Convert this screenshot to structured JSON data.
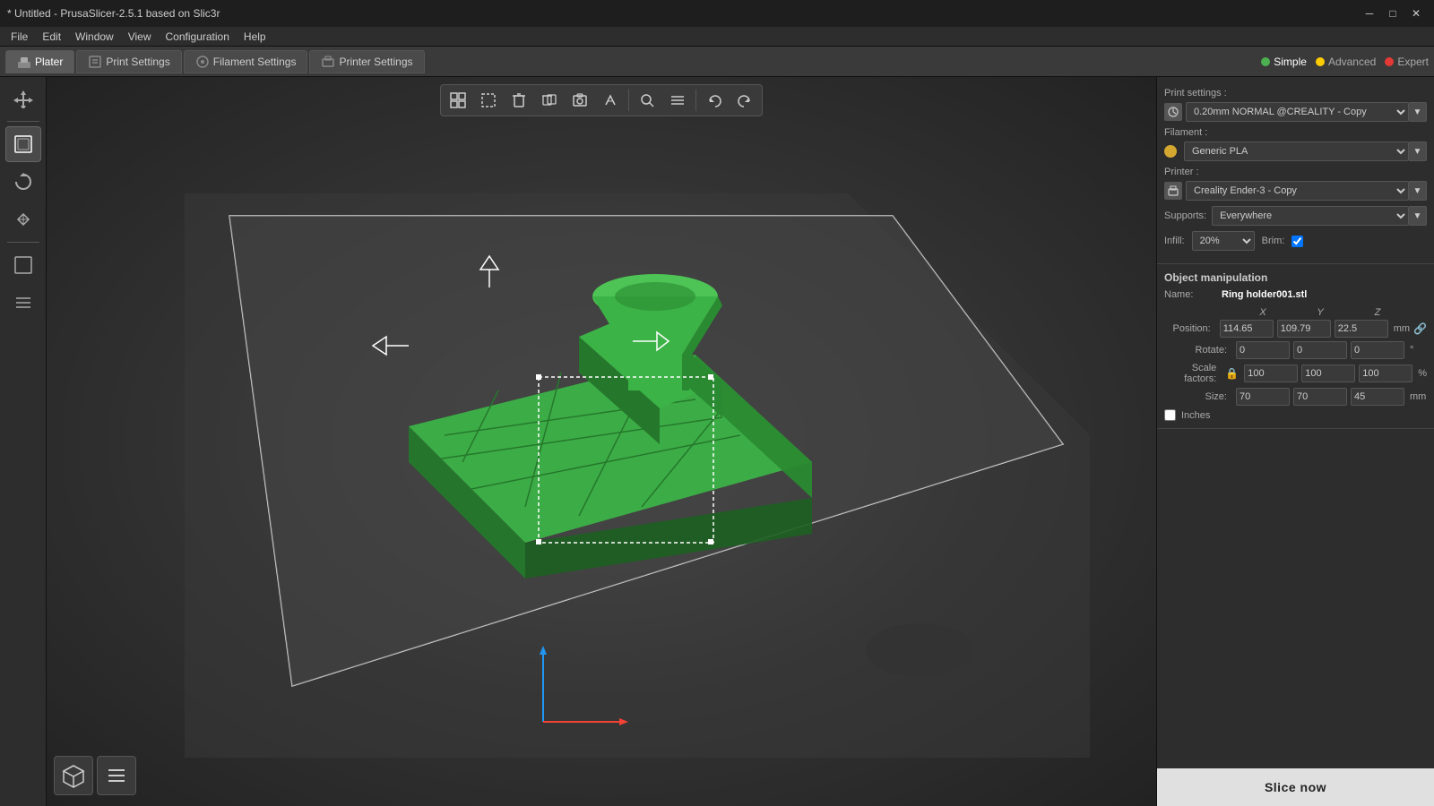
{
  "titlebar": {
    "title": "* Untitled - PrusaSlicer-2.5.1 based on Slic3r",
    "minimize": "─",
    "maximize": "□",
    "close": "✕"
  },
  "menubar": {
    "items": [
      "File",
      "Edit",
      "Window",
      "View",
      "Configuration",
      "Help"
    ]
  },
  "tabs": [
    {
      "id": "plater",
      "label": "Plater",
      "active": true
    },
    {
      "id": "print-settings",
      "label": "Print Settings",
      "active": false
    },
    {
      "id": "filament-settings",
      "label": "Filament Settings",
      "active": false
    },
    {
      "id": "printer-settings",
      "label": "Printer Settings",
      "active": false
    }
  ],
  "modes": [
    {
      "id": "simple",
      "label": "Simple",
      "dot": "green",
      "active": true
    },
    {
      "id": "advanced",
      "label": "Advanced",
      "dot": "yellow",
      "active": false
    },
    {
      "id": "expert",
      "label": "Expert",
      "dot": "red",
      "active": false
    }
  ],
  "viewport_tools": [
    {
      "id": "arrange",
      "icon": "⊞"
    },
    {
      "id": "select",
      "icon": "✦"
    },
    {
      "id": "cut",
      "icon": "⬡"
    },
    {
      "id": "layer",
      "icon": "⧠"
    },
    {
      "id": "support-paint",
      "icon": "◉"
    },
    {
      "id": "seam-paint",
      "icon": "⊙"
    },
    {
      "id": "search",
      "icon": "🔍"
    },
    {
      "id": "menu",
      "icon": "≡"
    },
    {
      "id": "undo",
      "icon": "↶"
    },
    {
      "id": "redo",
      "icon": "↷"
    }
  ],
  "left_tools": [
    {
      "id": "move",
      "icon": "✛",
      "active": false
    },
    {
      "id": "select-box",
      "icon": "⬚",
      "active": true
    },
    {
      "id": "rotate",
      "icon": "↻",
      "active": false
    },
    {
      "id": "scale",
      "icon": "⤡",
      "active": false
    },
    {
      "id": "cut-tool",
      "icon": "⬜",
      "active": false
    },
    {
      "id": "layers",
      "icon": "≡",
      "active": false
    }
  ],
  "right_panel": {
    "print_settings_label": "Print settings :",
    "print_settings_value": "0.20mm NORMAL @CREALITY - Copy",
    "filament_label": "Filament :",
    "filament_value": "Generic PLA",
    "printer_label": "Printer :",
    "printer_value": "Creality Ender-3 - Copy",
    "supports_label": "Supports:",
    "supports_value": "Everywhere",
    "infill_label": "Infill:",
    "infill_value": "20%",
    "brim_label": "Brim:",
    "brim_checked": true,
    "object_manipulation": {
      "title": "Object manipulation",
      "name_label": "Name:",
      "name_value": "Ring holder001.stl",
      "coords": {
        "x": "X",
        "y": "Y",
        "z": "Z"
      },
      "position_label": "Position:",
      "position_x": "114.65",
      "position_y": "109.79",
      "position_z": "22.5",
      "position_unit": "mm",
      "rotate_label": "Rotate:",
      "rotate_x": "0",
      "rotate_y": "0",
      "rotate_z": "0",
      "rotate_unit": "°",
      "scale_label": "Scale factors:",
      "scale_x": "100",
      "scale_y": "100",
      "scale_z": "100",
      "scale_unit": "%",
      "size_label": "Size:",
      "size_x": "70",
      "size_y": "70",
      "size_z": "45",
      "size_unit": "mm",
      "inches_label": "Inches",
      "inches_checked": false
    }
  },
  "slice_btn_label": "Slice now",
  "view_btns": [
    {
      "id": "3d-view",
      "icon": "⬡"
    },
    {
      "id": "layer-view",
      "icon": "≡"
    }
  ]
}
